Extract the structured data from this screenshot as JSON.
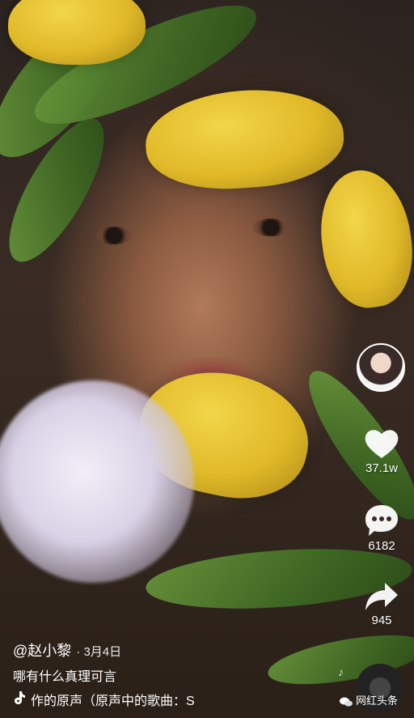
{
  "video": {
    "description_icons": [
      "tulip",
      "leaf",
      "white-flower"
    ]
  },
  "actions": {
    "likes": "37.1w",
    "comments": "6182",
    "shares": "945"
  },
  "author": {
    "handle": "@赵小黎",
    "date": "· 3月4日"
  },
  "caption": "哪有什么真理可言",
  "music": "作的原声（原声中的歌曲：S",
  "watermark": "网红头条",
  "colors": {
    "accent": "#ffffff",
    "tulip": "#e0b928",
    "leaf": "#3f6b23"
  }
}
